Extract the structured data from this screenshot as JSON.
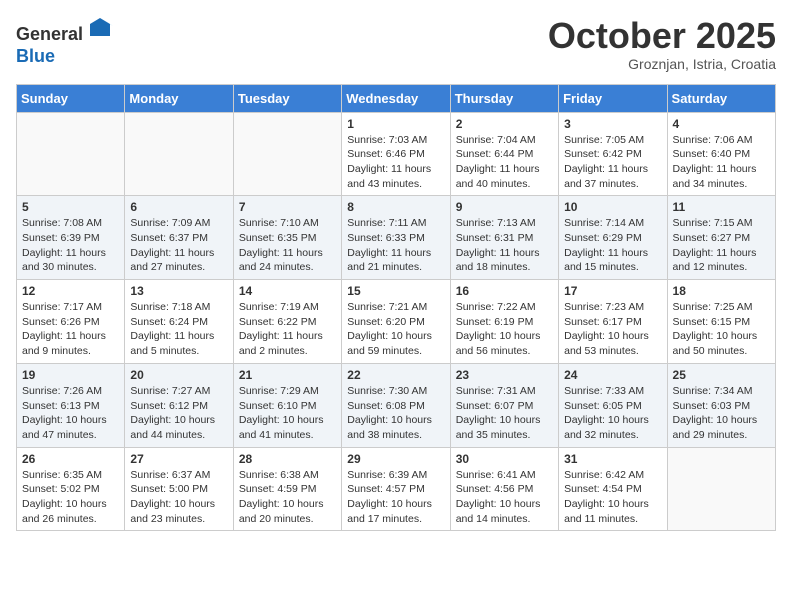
{
  "header": {
    "logo_line1": "General",
    "logo_line2": "Blue",
    "month": "October 2025",
    "location": "Groznjan, Istria, Croatia"
  },
  "weekdays": [
    "Sunday",
    "Monday",
    "Tuesday",
    "Wednesday",
    "Thursday",
    "Friday",
    "Saturday"
  ],
  "weeks": [
    [
      {
        "day": "",
        "info": ""
      },
      {
        "day": "",
        "info": ""
      },
      {
        "day": "",
        "info": ""
      },
      {
        "day": "1",
        "info": "Sunrise: 7:03 AM\nSunset: 6:46 PM\nDaylight: 11 hours\nand 43 minutes."
      },
      {
        "day": "2",
        "info": "Sunrise: 7:04 AM\nSunset: 6:44 PM\nDaylight: 11 hours\nand 40 minutes."
      },
      {
        "day": "3",
        "info": "Sunrise: 7:05 AM\nSunset: 6:42 PM\nDaylight: 11 hours\nand 37 minutes."
      },
      {
        "day": "4",
        "info": "Sunrise: 7:06 AM\nSunset: 6:40 PM\nDaylight: 11 hours\nand 34 minutes."
      }
    ],
    [
      {
        "day": "5",
        "info": "Sunrise: 7:08 AM\nSunset: 6:39 PM\nDaylight: 11 hours\nand 30 minutes."
      },
      {
        "day": "6",
        "info": "Sunrise: 7:09 AM\nSunset: 6:37 PM\nDaylight: 11 hours\nand 27 minutes."
      },
      {
        "day": "7",
        "info": "Sunrise: 7:10 AM\nSunset: 6:35 PM\nDaylight: 11 hours\nand 24 minutes."
      },
      {
        "day": "8",
        "info": "Sunrise: 7:11 AM\nSunset: 6:33 PM\nDaylight: 11 hours\nand 21 minutes."
      },
      {
        "day": "9",
        "info": "Sunrise: 7:13 AM\nSunset: 6:31 PM\nDaylight: 11 hours\nand 18 minutes."
      },
      {
        "day": "10",
        "info": "Sunrise: 7:14 AM\nSunset: 6:29 PM\nDaylight: 11 hours\nand 15 minutes."
      },
      {
        "day": "11",
        "info": "Sunrise: 7:15 AM\nSunset: 6:27 PM\nDaylight: 11 hours\nand 12 minutes."
      }
    ],
    [
      {
        "day": "12",
        "info": "Sunrise: 7:17 AM\nSunset: 6:26 PM\nDaylight: 11 hours\nand 9 minutes."
      },
      {
        "day": "13",
        "info": "Sunrise: 7:18 AM\nSunset: 6:24 PM\nDaylight: 11 hours\nand 5 minutes."
      },
      {
        "day": "14",
        "info": "Sunrise: 7:19 AM\nSunset: 6:22 PM\nDaylight: 11 hours\nand 2 minutes."
      },
      {
        "day": "15",
        "info": "Sunrise: 7:21 AM\nSunset: 6:20 PM\nDaylight: 10 hours\nand 59 minutes."
      },
      {
        "day": "16",
        "info": "Sunrise: 7:22 AM\nSunset: 6:19 PM\nDaylight: 10 hours\nand 56 minutes."
      },
      {
        "day": "17",
        "info": "Sunrise: 7:23 AM\nSunset: 6:17 PM\nDaylight: 10 hours\nand 53 minutes."
      },
      {
        "day": "18",
        "info": "Sunrise: 7:25 AM\nSunset: 6:15 PM\nDaylight: 10 hours\nand 50 minutes."
      }
    ],
    [
      {
        "day": "19",
        "info": "Sunrise: 7:26 AM\nSunset: 6:13 PM\nDaylight: 10 hours\nand 47 minutes."
      },
      {
        "day": "20",
        "info": "Sunrise: 7:27 AM\nSunset: 6:12 PM\nDaylight: 10 hours\nand 44 minutes."
      },
      {
        "day": "21",
        "info": "Sunrise: 7:29 AM\nSunset: 6:10 PM\nDaylight: 10 hours\nand 41 minutes."
      },
      {
        "day": "22",
        "info": "Sunrise: 7:30 AM\nSunset: 6:08 PM\nDaylight: 10 hours\nand 38 minutes."
      },
      {
        "day": "23",
        "info": "Sunrise: 7:31 AM\nSunset: 6:07 PM\nDaylight: 10 hours\nand 35 minutes."
      },
      {
        "day": "24",
        "info": "Sunrise: 7:33 AM\nSunset: 6:05 PM\nDaylight: 10 hours\nand 32 minutes."
      },
      {
        "day": "25",
        "info": "Sunrise: 7:34 AM\nSunset: 6:03 PM\nDaylight: 10 hours\nand 29 minutes."
      }
    ],
    [
      {
        "day": "26",
        "info": "Sunrise: 6:35 AM\nSunset: 5:02 PM\nDaylight: 10 hours\nand 26 minutes."
      },
      {
        "day": "27",
        "info": "Sunrise: 6:37 AM\nSunset: 5:00 PM\nDaylight: 10 hours\nand 23 minutes."
      },
      {
        "day": "28",
        "info": "Sunrise: 6:38 AM\nSunset: 4:59 PM\nDaylight: 10 hours\nand 20 minutes."
      },
      {
        "day": "29",
        "info": "Sunrise: 6:39 AM\nSunset: 4:57 PM\nDaylight: 10 hours\nand 17 minutes."
      },
      {
        "day": "30",
        "info": "Sunrise: 6:41 AM\nSunset: 4:56 PM\nDaylight: 10 hours\nand 14 minutes."
      },
      {
        "day": "31",
        "info": "Sunrise: 6:42 AM\nSunset: 4:54 PM\nDaylight: 10 hours\nand 11 minutes."
      },
      {
        "day": "",
        "info": ""
      }
    ]
  ]
}
